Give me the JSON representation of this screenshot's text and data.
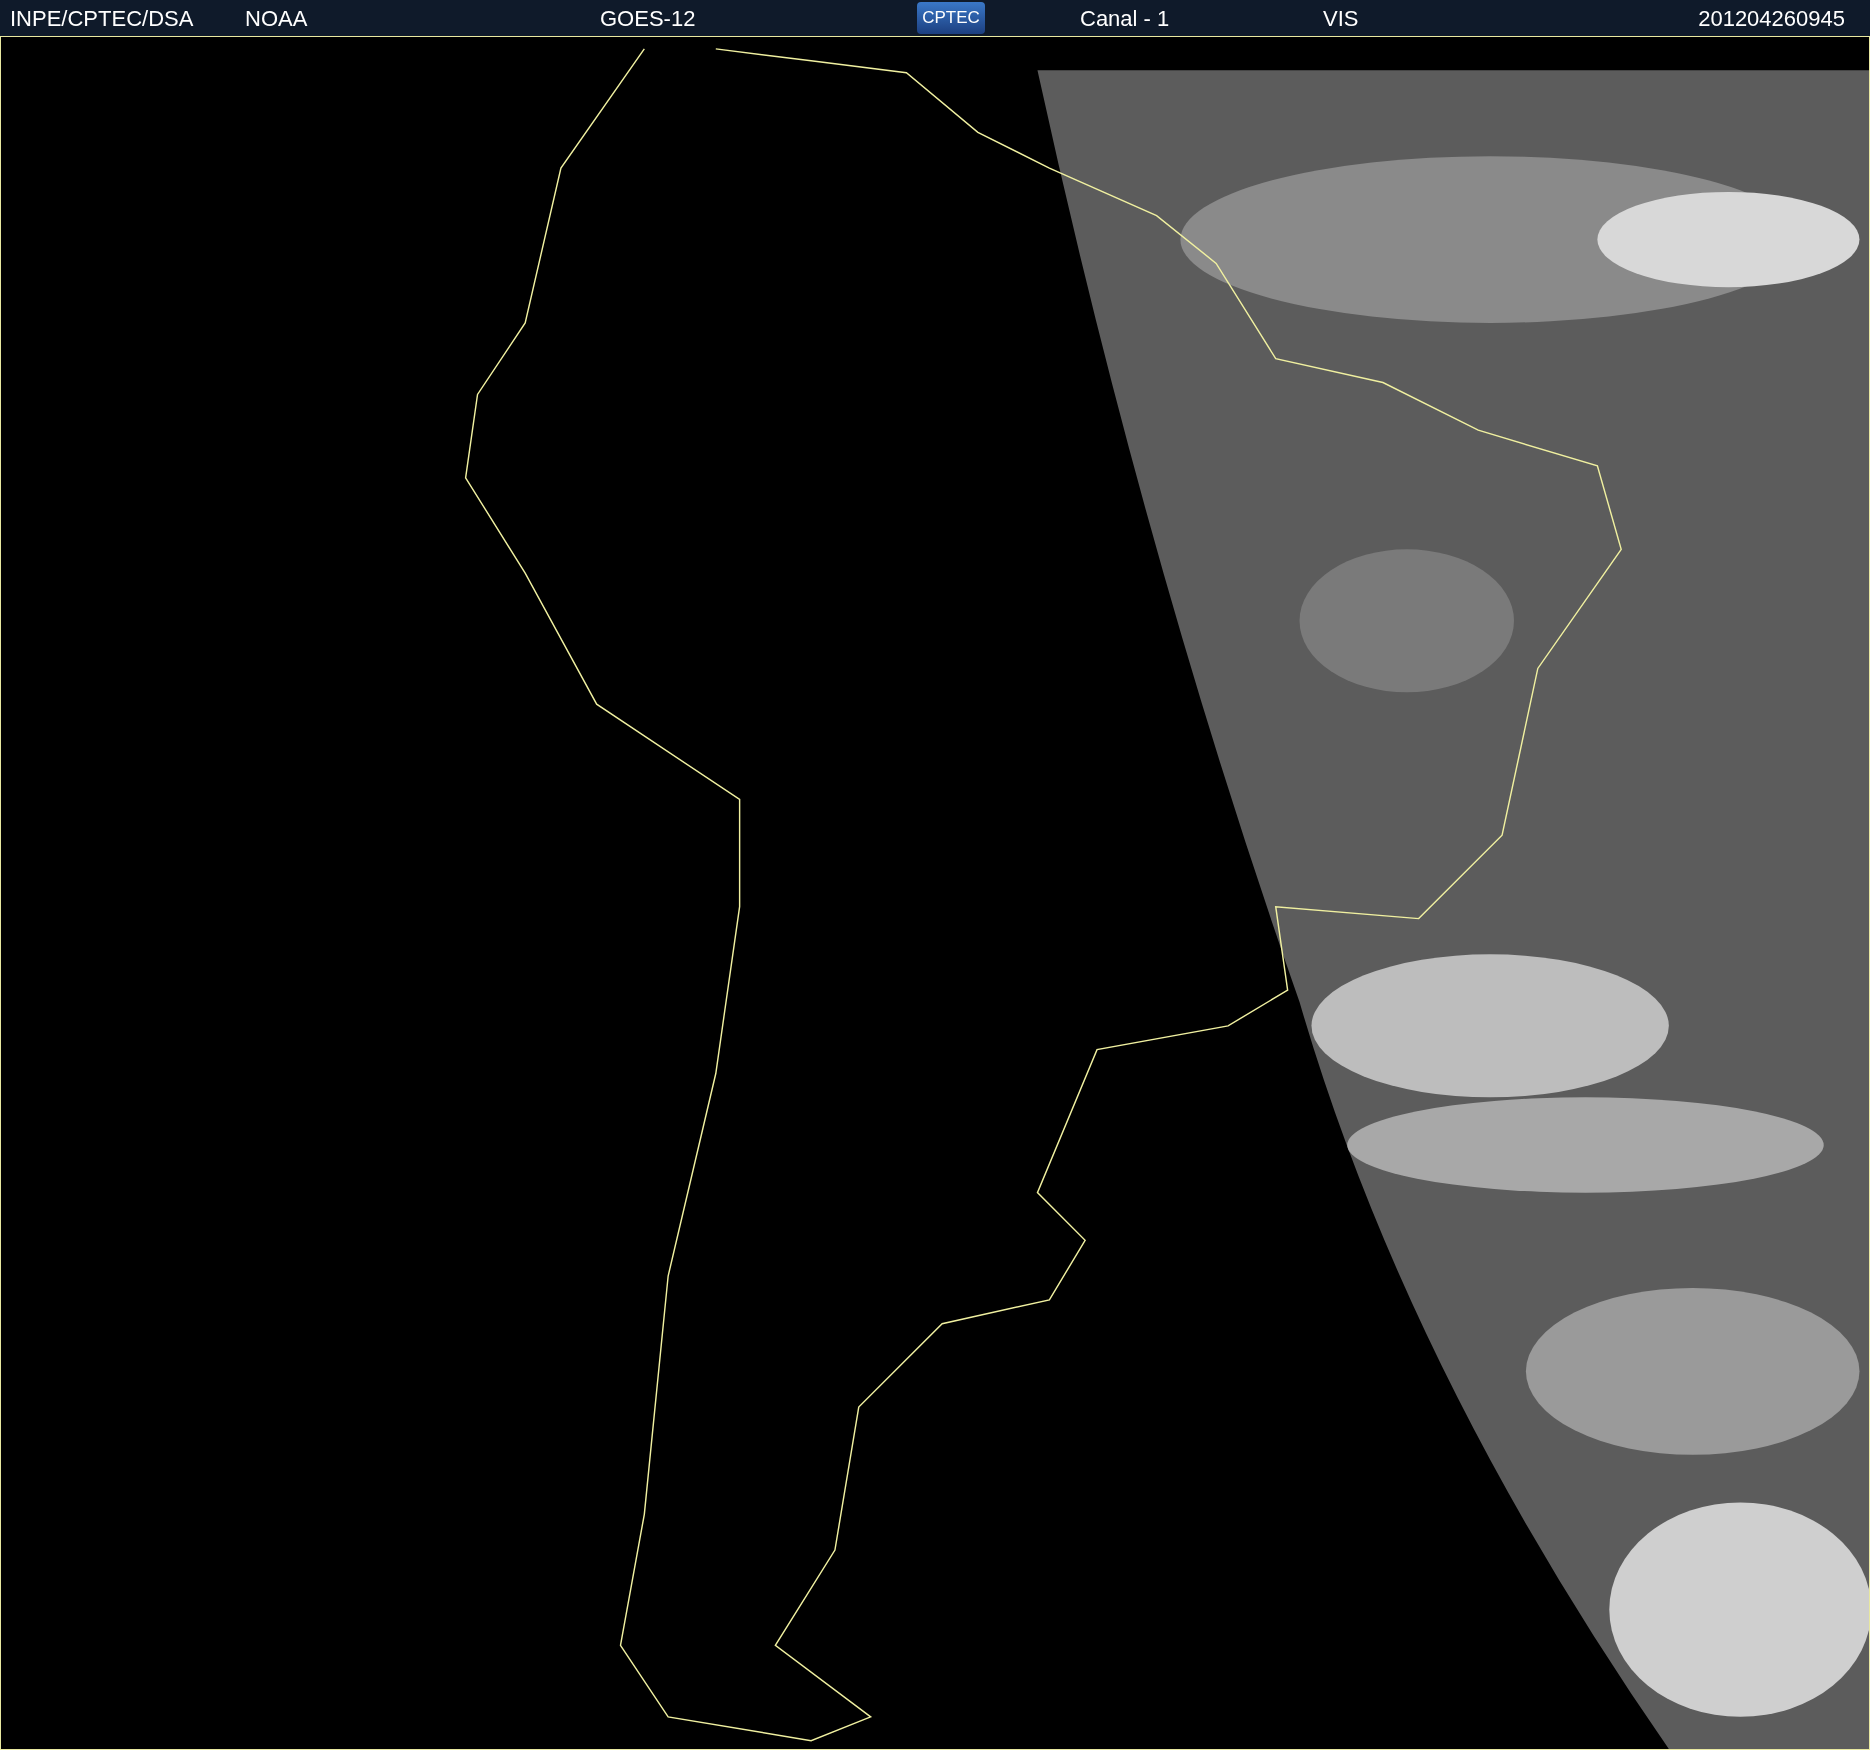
{
  "header": {
    "source": "INPE/CPTEC/DSA",
    "agency": "NOAA",
    "satellite": "GOES-12",
    "logo": "CPTEC",
    "channel": "Canal - 1",
    "band": "VIS",
    "timestamp": "201204260945"
  }
}
